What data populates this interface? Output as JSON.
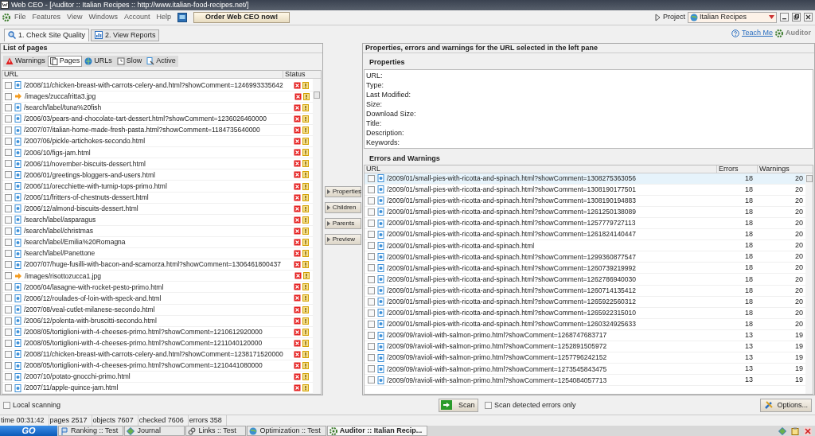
{
  "window": {
    "title": "Web CEO - [Auditor :: Italian Recipes :: http://www.italian-food-recipes.net/]"
  },
  "menu": [
    "File",
    "Features",
    "View",
    "Windows",
    "Account",
    "Help"
  ],
  "order_button": "Order Web CEO now!",
  "project": {
    "label": "Project",
    "value": "Italian Recipes"
  },
  "tabs": [
    {
      "label": "1. Check Site Quality",
      "selected": true
    },
    {
      "label": "2. View Reports",
      "selected": false
    }
  ],
  "teach_me": "Teach Me",
  "module": "Auditor",
  "left": {
    "title": "List of pages",
    "filters": [
      {
        "label": "Warnings",
        "selected": false,
        "kind": "warning"
      },
      {
        "label": "Pages",
        "selected": true,
        "kind": "pages"
      },
      {
        "label": "URLs",
        "selected": false,
        "kind": "urls"
      },
      {
        "label": "Slow",
        "selected": false,
        "kind": "slow"
      },
      {
        "label": "Active",
        "selected": false,
        "kind": "active"
      }
    ],
    "columns": [
      "URL",
      "Status"
    ],
    "rows": [
      {
        "url": "/2008/11/chicken-breast-with-carrots-celery-and.html?showComment=1246993335642",
        "kind": "page",
        "checked": false
      },
      {
        "url": "/images/zuccafritta3.jpg",
        "kind": "redirect",
        "checked": false
      },
      {
        "url": "/search/label/tuna%20fish",
        "kind": "page",
        "checked": false
      },
      {
        "url": "/2006/03/pears-and-chocolate-tart-dessert.html?showComment=1236026460000",
        "kind": "page",
        "checked": false
      },
      {
        "url": "/2007/07/italian-home-made-fresh-pasta.html?showComment=1184735640000",
        "kind": "page",
        "checked": false
      },
      {
        "url": "/2007/06/pickle-artichokes-secondo.html",
        "kind": "page",
        "checked": false
      },
      {
        "url": "/2006/10/figs-jam.html",
        "kind": "page",
        "checked": false
      },
      {
        "url": "/2006/11/november-biscuits-dessert.html",
        "kind": "page",
        "checked": false
      },
      {
        "url": "/2006/01/greetings-bloggers-and-users.html",
        "kind": "page",
        "checked": false
      },
      {
        "url": "/2006/11/orecchiette-with-turnip-tops-primo.html",
        "kind": "page",
        "checked": false
      },
      {
        "url": "/2006/11/fritters-of-chestnuts-dessert.html",
        "kind": "page",
        "checked": false
      },
      {
        "url": "/2006/12/almond-biscuits-dessert.html",
        "kind": "page",
        "checked": false
      },
      {
        "url": "/search/label/asparagus",
        "kind": "page",
        "checked": false
      },
      {
        "url": "/search/label/christmas",
        "kind": "page",
        "checked": false
      },
      {
        "url": "/search/label/Emilia%20Romagna",
        "kind": "page",
        "checked": false
      },
      {
        "url": "/search/label/Panettone",
        "kind": "page",
        "checked": false
      },
      {
        "url": "/2007/07/huge-fusilli-with-bacon-and-scamorza.html?showComment=1306461800437",
        "kind": "page",
        "checked": false
      },
      {
        "url": "/images/risottozucca1.jpg",
        "kind": "redirect",
        "checked": false
      },
      {
        "url": "/2006/04/lasagne-with-rocket-pesto-primo.html",
        "kind": "page",
        "checked": false
      },
      {
        "url": "/2006/12/roulades-of-loin-with-speck-and.html",
        "kind": "page",
        "checked": false
      },
      {
        "url": "/2007/08/veal-cutlet-milanese-secondo.html",
        "kind": "page",
        "checked": false
      },
      {
        "url": "/2006/12/polenta-with-bruscitti-secondo.html",
        "kind": "page",
        "checked": false
      },
      {
        "url": "/2008/05/tortiglioni-with-4-cheeses-primo.html?showComment=1210612920000",
        "kind": "page",
        "checked": false
      },
      {
        "url": "/2008/05/tortiglioni-with-4-cheeses-primo.html?showComment=1211040120000",
        "kind": "page",
        "checked": false
      },
      {
        "url": "/2008/11/chicken-breast-with-carrots-celery-and.html?showComment=1238171520000",
        "kind": "page",
        "checked": false
      },
      {
        "url": "/2008/05/tortiglioni-with-4-cheeses-primo.html?showComment=1210441080000",
        "kind": "page",
        "checked": false
      },
      {
        "url": "/2007/10/potato-gnocchi-primo.html",
        "kind": "page",
        "checked": false
      },
      {
        "url": "/2007/11/apple-quince-jam.html",
        "kind": "page",
        "checked": false
      }
    ]
  },
  "side_buttons": [
    "Properties",
    "Children",
    "Parents",
    "Preview"
  ],
  "right": {
    "title": "Properties, errors and warnings for the URL selected in the left pane",
    "properties_title": "Properties",
    "properties": [
      "URL:",
      "Type:",
      "Last Modified:",
      "Size:",
      "Download Size:",
      "Title:",
      "Description:",
      "Keywords:"
    ],
    "errors_title": "Errors and Warnings",
    "columns": [
      "URL",
      "Errors",
      "Warnings"
    ],
    "rows": [
      {
        "url": "/2009/01/small-pies-with-ricotta-and-spinach.html?showComment=1308275363056",
        "errors": "18",
        "warnings": "20",
        "selected": true,
        "checked": false
      },
      {
        "url": "/2009/01/small-pies-with-ricotta-and-spinach.html?showComment=1308190177501",
        "errors": "18",
        "warnings": "20",
        "selected": false,
        "checked": false
      },
      {
        "url": "/2009/01/small-pies-with-ricotta-and-spinach.html?showComment=1308190194883",
        "errors": "18",
        "warnings": "20",
        "selected": false,
        "checked": false
      },
      {
        "url": "/2009/01/small-pies-with-ricotta-and-spinach.html?showComment=1261250138089",
        "errors": "18",
        "warnings": "20",
        "selected": false,
        "checked": false
      },
      {
        "url": "/2009/01/small-pies-with-ricotta-and-spinach.html?showComment=1257779727113",
        "errors": "18",
        "warnings": "20",
        "selected": false,
        "checked": false
      },
      {
        "url": "/2009/01/small-pies-with-ricotta-and-spinach.html?showComment=1261824140447",
        "errors": "18",
        "warnings": "20",
        "selected": false,
        "checked": false
      },
      {
        "url": "/2009/01/small-pies-with-ricotta-and-spinach.html",
        "errors": "18",
        "warnings": "20",
        "selected": false,
        "checked": false
      },
      {
        "url": "/2009/01/small-pies-with-ricotta-and-spinach.html?showComment=1299360877547",
        "errors": "18",
        "warnings": "20",
        "selected": false,
        "checked": false
      },
      {
        "url": "/2009/01/small-pies-with-ricotta-and-spinach.html?showComment=1260739219992",
        "errors": "18",
        "warnings": "20",
        "selected": false,
        "checked": false
      },
      {
        "url": "/2009/01/small-pies-with-ricotta-and-spinach.html?showComment=1262786940030",
        "errors": "18",
        "warnings": "20",
        "selected": false,
        "checked": false
      },
      {
        "url": "/2009/01/small-pies-with-ricotta-and-spinach.html?showComment=1260714135412",
        "errors": "18",
        "warnings": "20",
        "selected": false,
        "checked": false
      },
      {
        "url": "/2009/01/small-pies-with-ricotta-and-spinach.html?showComment=1265922560312",
        "errors": "18",
        "warnings": "20",
        "selected": false,
        "checked": false
      },
      {
        "url": "/2009/01/small-pies-with-ricotta-and-spinach.html?showComment=1265922315010",
        "errors": "18",
        "warnings": "20",
        "selected": false,
        "checked": false
      },
      {
        "url": "/2009/01/small-pies-with-ricotta-and-spinach.html?showComment=1260324925633",
        "errors": "18",
        "warnings": "20",
        "selected": false,
        "checked": false
      },
      {
        "url": "/2009/09/ravioli-with-salmon-primo.html?showComment=1268747683717",
        "errors": "13",
        "warnings": "19",
        "selected": false,
        "checked": false
      },
      {
        "url": "/2009/09/ravioli-with-salmon-primo.html?showComment=1252891505972",
        "errors": "13",
        "warnings": "19",
        "selected": false,
        "checked": false
      },
      {
        "url": "/2009/09/ravioli-with-salmon-primo.html?showComment=1257796242152",
        "errors": "13",
        "warnings": "19",
        "selected": false,
        "checked": false
      },
      {
        "url": "/2009/09/ravioli-with-salmon-primo.html?showComment=1273545843475",
        "errors": "13",
        "warnings": "19",
        "selected": false,
        "checked": false
      },
      {
        "url": "/2009/09/ravioli-with-salmon-primo.html?showComment=1254084057713",
        "errors": "13",
        "warnings": "19",
        "selected": false,
        "checked": false
      }
    ]
  },
  "bottom": {
    "local_scanning": {
      "label": "Local scanning",
      "checked": false
    },
    "scan": "Scan",
    "errors_only": {
      "label": "Scan detected errors only",
      "checked": false
    },
    "options": "Options..."
  },
  "status_bar": [
    "time 00:31:42",
    "pages 2517",
    "objects 7607",
    "checked 7606",
    "errors 358"
  ],
  "taskbar": {
    "go": "GO",
    "items": [
      {
        "label": "Ranking :: Test",
        "selected": false
      },
      {
        "label": "Journal",
        "selected": false
      },
      {
        "label": "Links :: Test",
        "selected": false
      },
      {
        "label": "Optimization :: Test",
        "selected": false
      },
      {
        "label": "Auditor :: Italian Recip...",
        "selected": true
      }
    ]
  }
}
